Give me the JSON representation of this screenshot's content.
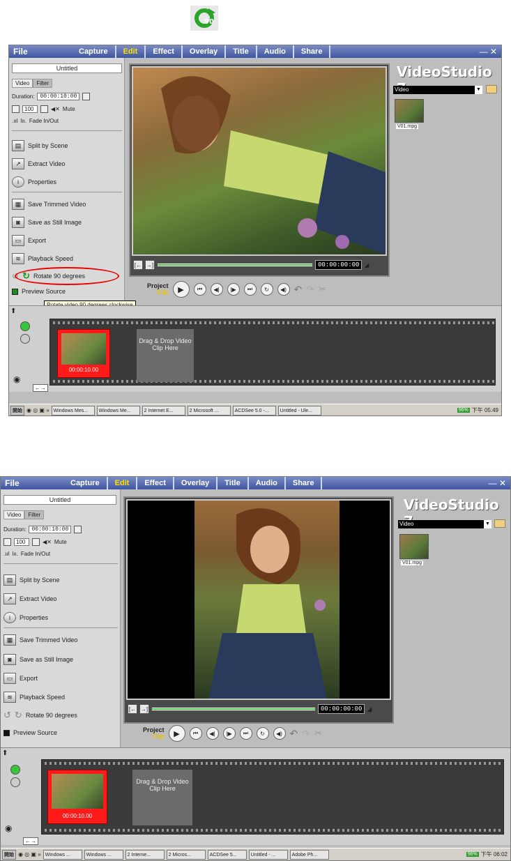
{
  "menu": {
    "file": "File",
    "tabs": [
      "Capture",
      "Edit",
      "Effect",
      "Overlay",
      "Title",
      "Audio",
      "Share"
    ],
    "close": "— ✕"
  },
  "brand": "VideoStudio 7",
  "project_title": "Untitled",
  "panel_tabs": {
    "video": "Video",
    "filter": "Filter"
  },
  "duration_label": "Duration:",
  "duration_value": "00:00:10:00",
  "volume": "100",
  "mute": "Mute",
  "fade": "Fade In/Out",
  "buttons": {
    "split": "Split by Scene",
    "extract": "Extract Video",
    "properties": "Properties",
    "save_trimmed": "Save Trimmed Video",
    "save_still": "Save as Still Image",
    "export": "Export",
    "playback": "Playback Speed",
    "rotate": "Rotate 90 degrees",
    "preview_source": "Preview Source"
  },
  "tooltip": "Rotate video 90 degrees clockwise",
  "timecode": "00:00:00:00",
  "project_label": "Project",
  "clip_label": "Clip",
  "library": {
    "category": "Video",
    "file": "V01.mpg"
  },
  "clip_time": "00:00:10.00",
  "drop_text": "Drag & Drop Video Clip Here",
  "taskbar1": {
    "start": "開始",
    "items": [
      "Windows Mes...",
      "Windows Me...",
      "2 Internet E...",
      "2 Microsoft ...",
      "ACDSee 5.0 -...",
      "Untitled - Ule..."
    ],
    "battery": "96%",
    "clock": "下午 05:49"
  },
  "taskbar2": {
    "start": "開始",
    "items": [
      "Windows ...",
      "Windows ...",
      "2 Interne...",
      "2 Micros...",
      "ACDSee 5...",
      "Untitled - ...",
      "Adobe Ph..."
    ],
    "battery": "96%",
    "clock": "下午 06:02"
  },
  "colors": {
    "menu": "#3f55a0",
    "active_tab": "#ffe100",
    "clip": "#ff1a1a",
    "highlight": "#e00000"
  }
}
